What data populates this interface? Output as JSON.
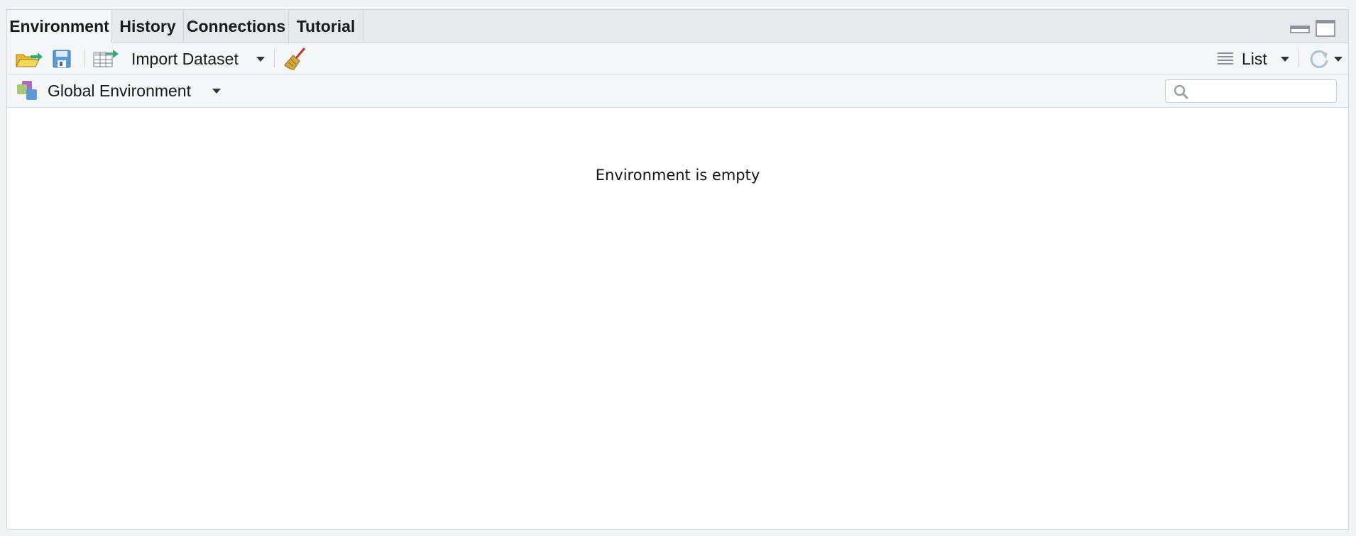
{
  "tabs": [
    {
      "label": "Environment",
      "active": true
    },
    {
      "label": "History",
      "active": false
    },
    {
      "label": "Connections",
      "active": false
    },
    {
      "label": "Tutorial",
      "active": false
    }
  ],
  "toolbar": {
    "import_dataset_label": "Import Dataset",
    "view_mode_label": "List",
    "icons": [
      "open-folder-icon",
      "save-icon",
      "import-dataset-icon",
      "broom-icon",
      "list-view-icon",
      "refresh-icon"
    ]
  },
  "env_bar": {
    "environment_label": "Global Environment",
    "search_placeholder": ""
  },
  "content": {
    "empty_message": "Environment is empty"
  },
  "colors": {
    "accent_green": "#2fae7a",
    "folder_yellow": "#f2c744",
    "save_blue": "#5b9bd5"
  }
}
